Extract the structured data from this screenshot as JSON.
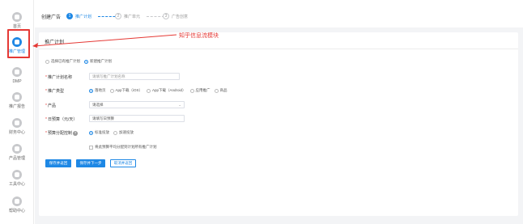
{
  "sidebar": {
    "items": [
      {
        "label": "首页",
        "icon": "home-icon"
      },
      {
        "label": "推广管理",
        "icon": "promotion-icon",
        "active": true
      },
      {
        "label": "DMP",
        "icon": "dmp-icon"
      },
      {
        "label": "推广报告",
        "icon": "report-icon"
      },
      {
        "label": "财务中心",
        "icon": "finance-icon"
      },
      {
        "label": "产品管理",
        "icon": "product-icon"
      },
      {
        "label": "工具中心",
        "icon": "tools-icon"
      },
      {
        "label": "帮助中心",
        "icon": "help-center-icon"
      }
    ]
  },
  "header": {
    "title": "创建广告",
    "steps": [
      {
        "num": "1",
        "label": "推广计划",
        "active": true
      },
      {
        "num": "2",
        "label": "推广单元",
        "active": false
      },
      {
        "num": "3",
        "label": "广告创意",
        "active": false
      }
    ]
  },
  "card": {
    "title": "推广计划",
    "plan_choice": {
      "existing": "选择已有推广计划",
      "new": "新建推广计划",
      "selected": "new"
    },
    "plan_name": {
      "label": "推广计划名称",
      "placeholder": "请填写推广计划名称"
    },
    "promo_type": {
      "label": "推广类型",
      "options": [
        "落地页",
        "App下载（iOS）",
        "App下载（Android）",
        "应用推广",
        "商品"
      ],
      "selected": 0
    },
    "product": {
      "label": "产品",
      "value": "请选择"
    },
    "daily_budget": {
      "label": "日预算（元/天）",
      "value": "请填写日预算"
    },
    "budget_mode": {
      "label": "预算分配控制",
      "options": [
        "标准投放",
        "加速投放"
      ],
      "selected": 0
    },
    "uniform_checkbox": {
      "label": "将此预算平均分配到计划所有推广计划"
    }
  },
  "buttons": {
    "save_draft": "保存并返回",
    "save_next": "保存并下一步",
    "cancel": "取消并返回"
  },
  "annotation": {
    "text": "知乎信息流模块",
    "color": "#e53935"
  },
  "colors": {
    "accent": "#1e88e5",
    "highlight": "#e53935"
  }
}
